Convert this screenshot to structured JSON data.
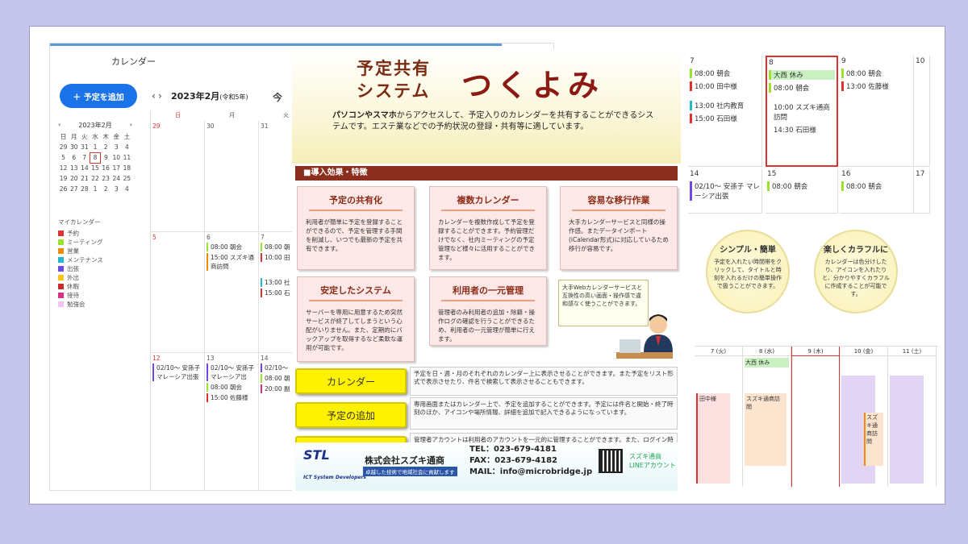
{
  "calendar": {
    "title": "カレンダー",
    "add_button": "＋ 予定を追加",
    "month": "2023年2月",
    "era": "(令和5年)",
    "today_btn": "今",
    "mini": {
      "header": "2023年2月",
      "weekdays": [
        "日",
        "月",
        "火",
        "水",
        "木",
        "金",
        "土"
      ],
      "rows": [
        [
          "29",
          "30",
          "31",
          "1",
          "2",
          "3",
          "4"
        ],
        [
          "5",
          "6",
          "7",
          "8",
          "9",
          "10",
          "11"
        ],
        [
          "12",
          "13",
          "14",
          "15",
          "16",
          "17",
          "18"
        ],
        [
          "19",
          "20",
          "21",
          "22",
          "23",
          "24",
          "25"
        ],
        [
          "26",
          "27",
          "28",
          "1",
          "2",
          "3",
          "4"
        ]
      ]
    },
    "mycal_title": "マイカレンダー",
    "mycal": [
      {
        "label": "予約",
        "color": "#e03131"
      },
      {
        "label": "ミーティング",
        "color": "#9be22d"
      },
      {
        "label": "営業",
        "color": "#f08c00"
      },
      {
        "label": "メンテナンス",
        "color": "#22b8cf"
      },
      {
        "label": "出張",
        "color": "#7048e8"
      },
      {
        "label": "外出",
        "color": "#fcc419"
      },
      {
        "label": "休暇",
        "color": "#c92a2a"
      },
      {
        "label": "接待",
        "color": "#d63384"
      },
      {
        "label": "勉強会",
        "color": "#f3c4f3"
      }
    ],
    "day_headers": [
      "日",
      "月",
      "火"
    ],
    "row1": [
      "29",
      "30",
      "31"
    ],
    "row2": [
      "5",
      "6",
      "7"
    ],
    "row3": [
      "12",
      "13",
      "14"
    ],
    "ev_6a": "08:00 朝会",
    "ev_6b": "15:00 スズキ通商訪問",
    "ev_7a": "08:00 朝",
    "ev_7b": "10:00 田",
    "ev_7c": "13:00 社",
    "ev_7d": "15:00 石",
    "ev_12": "02/10～ 安孫子 マレーシア出張",
    "ev_13a": "02/10～ 安孫子 マレーシア出",
    "ev_13b": "08:00 朝会",
    "ev_13c": "15:00 佐藤様",
    "ev_14a": "02/10～",
    "ev_14b": "08:00 朝",
    "ev_14c": "20:00 副"
  },
  "flyer": {
    "title1": "予定共有",
    "title2": "システム",
    "brand": "つくよみ",
    "intro_bold": "パソコンやスマホ",
    "intro": "からアクセスして、予定入りのカレンダーを共有することができるシステムです。エステ業などでの予約状況の登録・共有等に適しています。",
    "section": "■導入効果・特徴",
    "features": [
      {
        "title": "予定の共有化",
        "text": "利用者が簡単に予定を登録することができるので、予定を管理する手間を削減し、いつでも最新の予定を共有できます。"
      },
      {
        "title": "複数カレンダー",
        "text": "カレンダーを複数作成して予定を登録することができます。予約管理だけでなく、社内ミーティングの予定管理など様々に活用することができます。"
      },
      {
        "title": "容易な移行作業",
        "text": "大手カレンダーサービスと同様の操作感。またデータインポート(iCalendar形式)に対応しているため移行が容易です。"
      },
      {
        "title": "安定したシステム",
        "text": "サーバーを専用に用意するため突然サービスが終了してしまうという心配がいりません。また、定期的にバックアップを取得するなど柔軟な運用が可能です。"
      },
      {
        "title": "利用者の一元管理",
        "text": "管理者のみ利用者の追加・除籍・操作ログの確認を行うことができるため、利用者の一元管理が簡単に行えます。"
      }
    ],
    "bubble": "大手Webカレンダーサービスと互換性の高い画面・操作感で違和感なく使うことができます。",
    "buttons": [
      {
        "label": "カレンダー",
        "desc": "予定を日・週・月のそれぞれのカレンダー上に表示させることができます。また予定をリスト形式で表示させたり、件名で検索して表示させることもできます。"
      },
      {
        "label": "予定の追加",
        "desc": "専用画面またはカレンダー上で、予定を追加することができます。予定には件名と開始・終了時刻のほか、アイコンや場所情報、詳細を追加で記入できるようになっています。"
      },
      {
        "label": "管理機能",
        "desc": "管理者アカウントは利用者のアカウントを一元的に管理することができます。また、ログイン時刻や予定の追加、削除等の操作ログを記録しているため後から誰がどのような操作をおこなったか追跡することができます。"
      }
    ],
    "logo": "STL",
    "company": "株式会社スズキ通商",
    "tagline": "卓越した技術で地域社会に貢献します",
    "devs": "ICT System Developers",
    "tel": "TEL：023-679-4181",
    "fax": "FAX：023-679-4182",
    "mail": "MAIL：info@microbridge.jp",
    "line1": "スズキ通商",
    "line2": "LINEアカウント"
  },
  "week": {
    "d7": "7",
    "d8": "8",
    "d9": "9",
    "d10": "10",
    "d14": "14",
    "d15": "15",
    "d16": "16",
    "d17": "17",
    "e7a": "08:00 朝会",
    "e7b": "10:00 田中様",
    "e7c": "13:00 社内教育",
    "e7d": "15:00 石田様",
    "e8a": "大西 休み",
    "e8b": "08:00 朝会",
    "e8c": "10:00 スズキ通商訪問",
    "e8d": "14:30 石田様",
    "e9a": "08:00 朝会",
    "e9b": "13:00 佐藤様",
    "e14": "02/10～ 安孫子 マレーシア出張",
    "e15": "08:00 朝会",
    "e16": "08:00 朝会"
  },
  "circles": [
    {
      "title": "シンプル・簡単",
      "text": "予定を入れたい時間帯をクリックして、タイトルと時刻を入れるだけの簡単操作で扱うことができます。"
    },
    {
      "title": "楽しくカラフルに",
      "text": "カレンダーは色分けしたり、アイコンを入れたりと、分かりやすくカラフルに作成することが可能です。"
    }
  ],
  "timeline": {
    "cols": [
      "7 (火)",
      "8 (水)",
      "9 (木)",
      "10 (金)",
      "11 (土)"
    ],
    "allday": "大西 休み",
    "ev1": "田中様",
    "ev2": "スズキ通商訪問",
    "ev3": "スズキ通商訪問"
  }
}
